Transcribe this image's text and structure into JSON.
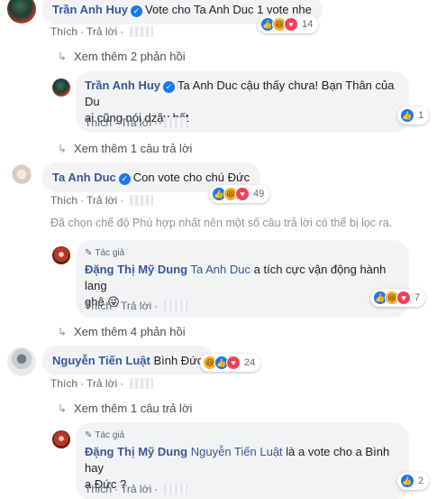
{
  "actions": {
    "like": "Thích",
    "reply": "Trả lời"
  },
  "author_tag": "Tác giả",
  "icons": {
    "like": "like-icon",
    "haha": "haha-icon",
    "love": "love-icon",
    "author": "pen-icon",
    "reply_arrow": "reply-arrow-icon"
  },
  "comments": [
    {
      "name": "Trần Anh Huy",
      "mention": "",
      "text": "Vote cho Ta Anh Duc 1 vote nhe",
      "reaction_count": "14"
    },
    {
      "name": "Trần Anh Huy",
      "mention": "",
      "text_line1": "Ta Anh Duc cậu thấy chưa! Bạn Thân của Du",
      "text_line2": "ai cũng nói dzậy hết",
      "reaction_count": "1"
    },
    {
      "name": "Ta Anh Duc",
      "mention": "",
      "text": "Con vote cho chú Đức",
      "reaction_count": "49"
    },
    {
      "name": "Đặng Thị Mỹ Dung",
      "mention": "Ta Anh Duc",
      "text_line1": "a tích cực vận động hành lang",
      "text_line2": "ghê 😜",
      "reaction_count": "7"
    },
    {
      "name": "Nguyễn Tiến Luật",
      "mention": "",
      "text": "Bình Đức",
      "reaction_count": "24"
    },
    {
      "name": "Đặng Thị Mỹ Dung",
      "mention": "Nguyễn Tiến Luật",
      "text_line1": "là a vote cho a Bình hay",
      "text_line2": "a Đức ?",
      "reaction_count": "2"
    }
  ],
  "more": {
    "see_2_replies": "Xem thêm 2 phản hồi",
    "see_1_reply_a": "Xem thêm 1 câu trả lời",
    "see_4_replies": "Xem thêm 4 phản hồi",
    "see_1_reply_b": "Xem thêm 1 câu trả lời"
  },
  "filter_notice": "Đã chọn chế độ Phù hợp nhất nên một số câu trả lời có thể bị lọc ra."
}
